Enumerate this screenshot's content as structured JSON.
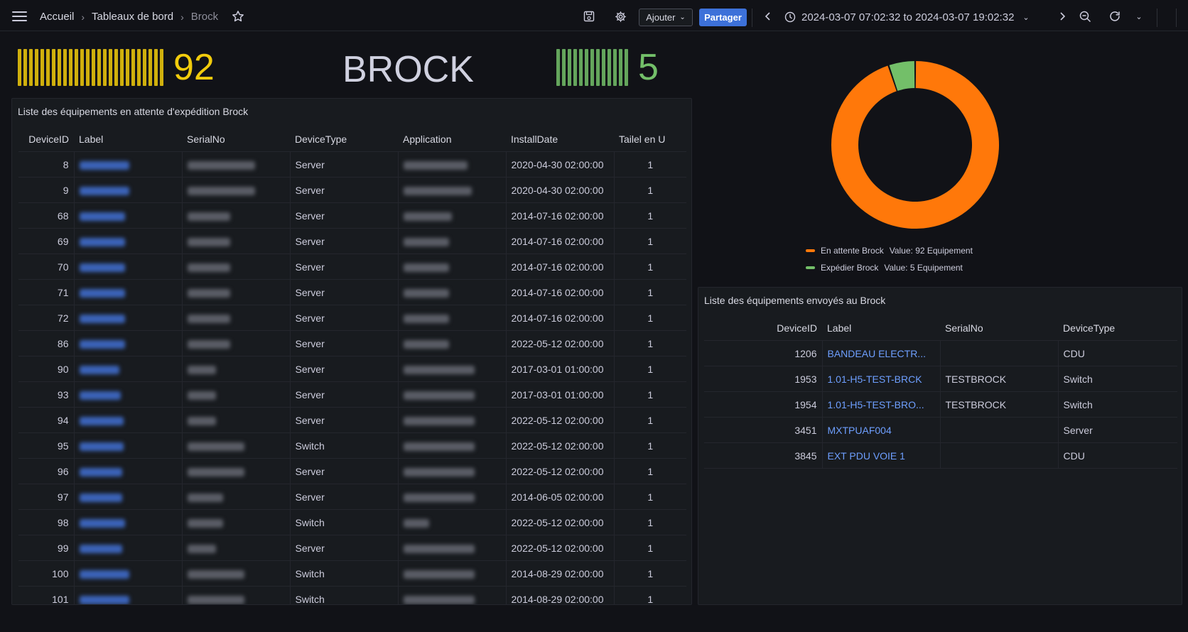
{
  "nav": {
    "breadcrumbs": [
      "Accueil",
      "Tableaux de bord",
      "Brock"
    ],
    "add_label": "Ajouter",
    "share_label": "Partager",
    "time_range": "2024-03-07 07:02:32 to 2024-03-07 19:02:32"
  },
  "stats": {
    "pending": {
      "value": "92",
      "color": "#f2cc0c"
    },
    "title": "BROCK",
    "shipped": {
      "value": "5",
      "color": "#73bf69"
    }
  },
  "pending_table": {
    "title": "Liste des équipements en attente d'expédition Brock",
    "columns": [
      "DeviceID",
      "Label",
      "SerialNo",
      "DeviceType",
      "Application",
      "InstallDate",
      "Tailel en U"
    ],
    "rows": [
      {
        "id": "8",
        "type": "Server",
        "date": "2020-04-30 02:00:00",
        "u": "1"
      },
      {
        "id": "9",
        "type": "Server",
        "date": "2020-04-30 02:00:00",
        "u": "1"
      },
      {
        "id": "68",
        "type": "Server",
        "date": "2014-07-16 02:00:00",
        "u": "1"
      },
      {
        "id": "69",
        "type": "Server",
        "date": "2014-07-16 02:00:00",
        "u": "1"
      },
      {
        "id": "70",
        "type": "Server",
        "date": "2014-07-16 02:00:00",
        "u": "1"
      },
      {
        "id": "71",
        "type": "Server",
        "date": "2014-07-16 02:00:00",
        "u": "1"
      },
      {
        "id": "72",
        "type": "Server",
        "date": "2014-07-16 02:00:00",
        "u": "1"
      },
      {
        "id": "86",
        "type": "Server",
        "date": "2022-05-12 02:00:00",
        "u": "1"
      },
      {
        "id": "90",
        "type": "Server",
        "date": "2017-03-01 01:00:00",
        "u": "1"
      },
      {
        "id": "93",
        "type": "Server",
        "date": "2017-03-01 01:00:00",
        "u": "1"
      },
      {
        "id": "94",
        "type": "Server",
        "date": "2022-05-12 02:00:00",
        "u": "1"
      },
      {
        "id": "95",
        "type": "Switch",
        "date": "2022-05-12 02:00:00",
        "u": "1"
      },
      {
        "id": "96",
        "type": "Server",
        "date": "2022-05-12 02:00:00",
        "u": "1"
      },
      {
        "id": "97",
        "type": "Server",
        "date": "2014-06-05 02:00:00",
        "u": "1"
      },
      {
        "id": "98",
        "type": "Switch",
        "date": "2022-05-12 02:00:00",
        "u": "1"
      },
      {
        "id": "99",
        "type": "Server",
        "date": "2022-05-12 02:00:00",
        "u": "1"
      },
      {
        "id": "100",
        "type": "Switch",
        "date": "2014-08-29 02:00:00",
        "u": "1"
      },
      {
        "id": "101",
        "type": "Switch",
        "date": "2014-08-29 02:00:00",
        "u": "1"
      }
    ]
  },
  "donut": {
    "legend": [
      {
        "label": "En attente Brock",
        "value": "Value: 92 Equipement",
        "color": "#ff780a"
      },
      {
        "label": "Expédier Brock",
        "value": "Value: 5 Equipement",
        "color": "#73bf69"
      }
    ]
  },
  "shipped_table": {
    "title": "Liste des équipements envoyés au Brock",
    "columns": [
      "DeviceID",
      "Label",
      "SerialNo",
      "DeviceType"
    ],
    "rows": [
      {
        "id": "1206",
        "label": "BANDEAU ELECTR...",
        "serial": "",
        "type": "CDU"
      },
      {
        "id": "1953",
        "label": "1.01-H5-TEST-BRCK",
        "serial": "TESTBROCK",
        "type": "Switch"
      },
      {
        "id": "1954",
        "label": "1.01-H5-TEST-BRO...",
        "serial": "TESTBROCK",
        "type": "Switch"
      },
      {
        "id": "3451",
        "label": "MXTPUAF004",
        "serial": "",
        "type": "Server"
      },
      {
        "id": "3845",
        "label": "EXT PDU VOIE 1",
        "serial": "",
        "type": "CDU"
      }
    ]
  },
  "chart_data": {
    "type": "pie",
    "categories": [
      "En attente Brock",
      "Expédier Brock"
    ],
    "values": [
      92,
      5
    ],
    "colors": [
      "#ff780a",
      "#73bf69"
    ]
  }
}
